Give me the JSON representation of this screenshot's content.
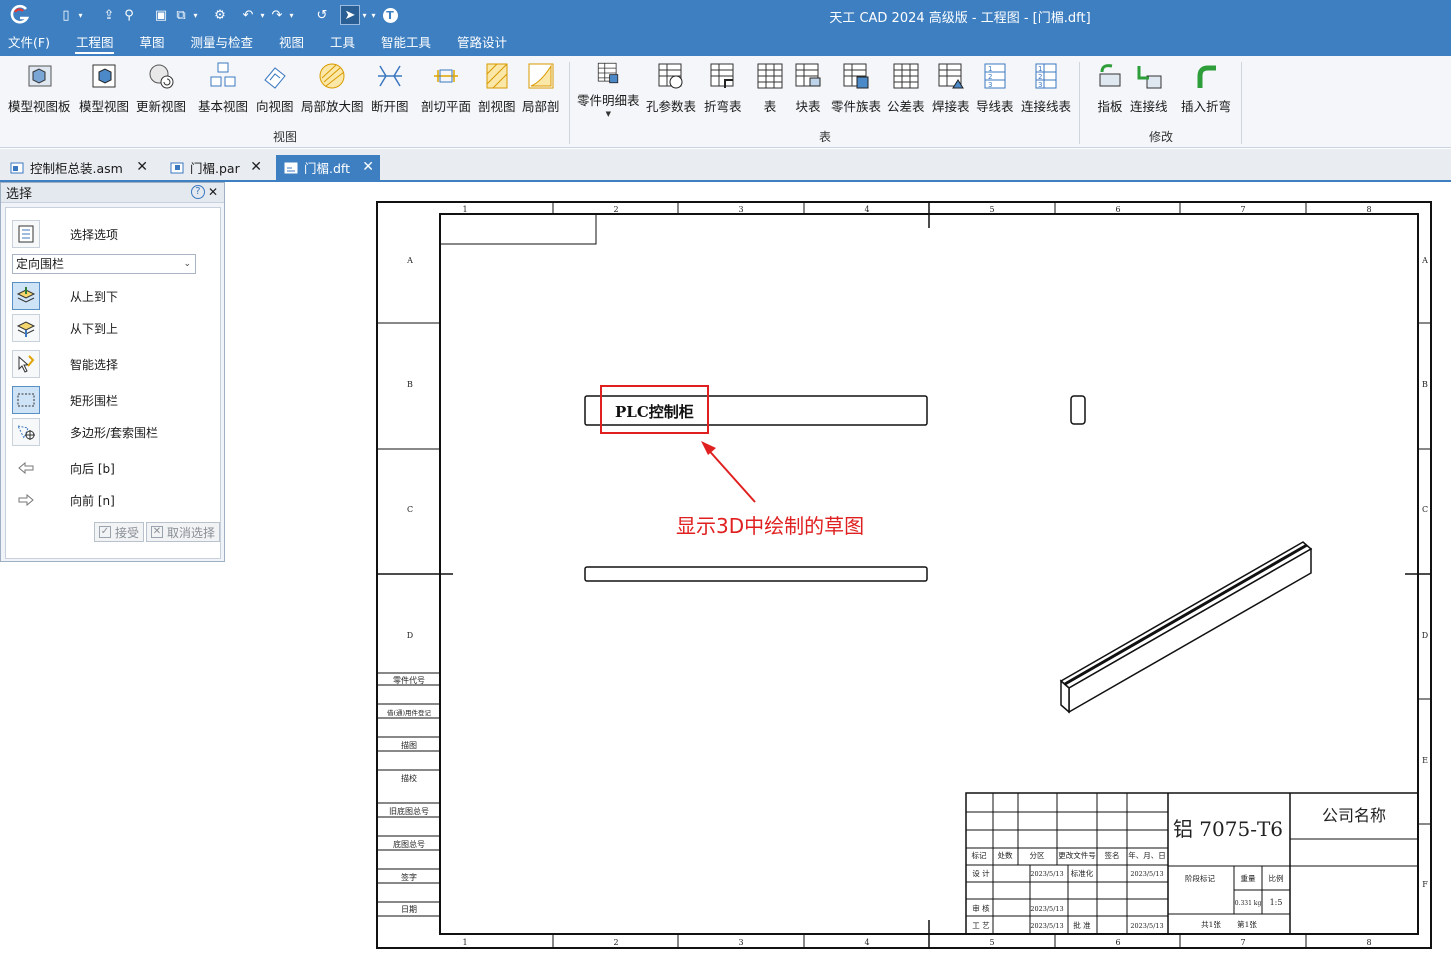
{
  "window": {
    "title": "天工 CAD 2024 高级版 - 工程图 - [门楣.dft]"
  },
  "menu": [
    "文件(F)",
    "工程图",
    "草图",
    "测量与检查",
    "视图",
    "工具",
    "智能工具",
    "管路设计"
  ],
  "ribbon": {
    "groups": [
      {
        "label": "视图",
        "buttons": [
          "模型视图板",
          "模型视图",
          "更新视图",
          "基本视图",
          "向视图",
          "局部放大图",
          "断开图",
          "剖切平面",
          "剖视图",
          "局部剖"
        ]
      },
      {
        "label": "表",
        "buttons": [
          "零件明细表",
          "孔参数表",
          "折弯表",
          "表",
          "块表",
          "零件族表",
          "公差表",
          "焊接表",
          "导线表",
          "连接线表"
        ]
      },
      {
        "label": "修改",
        "buttons": [
          "指板",
          "连接线",
          "插入折弯"
        ]
      }
    ]
  },
  "doc_tabs": [
    {
      "name": "控制柜总装.asm",
      "active": false
    },
    {
      "name": "门楣.par",
      "active": false
    },
    {
      "name": "门楣.dft",
      "active": true
    }
  ],
  "select_panel": {
    "title": "选择",
    "options_label": "选择选项",
    "fence_mode": "定向围栏",
    "items": [
      "从上到下",
      "从下到上",
      "智能选择",
      "矩形围栏",
      "多边形/套索围栏",
      "向后 [b]",
      "向前 [n]"
    ],
    "accept": "接受",
    "cancel": "取消选择"
  },
  "drawing": {
    "col_numbers": [
      "1",
      "2",
      "3",
      "4",
      "5",
      "6",
      "7",
      "8"
    ],
    "row_letters_left": [
      "A",
      "B",
      "C",
      "D"
    ],
    "row_letters_right": [
      "A",
      "B",
      "C",
      "D",
      "E",
      "F"
    ],
    "left_strip": [
      "零件代号",
      "借(通)用件登记",
      "描图",
      "描校",
      "旧底图总号",
      "底图总号",
      "签字",
      "日期"
    ],
    "sketch_text": "PLC控制柜",
    "annotation": "显示3D中绘制的草图",
    "title_block": {
      "material": "铝 7075-T6",
      "company": "公司名称",
      "headers": [
        "标记",
        "处数",
        "分区",
        "更改文件号",
        "签名",
        "年、月、日"
      ],
      "design": "设 计",
      "standardize": "标准化",
      "review": "审 核",
      "process": "工 艺",
      "approve": "批 准",
      "date": "2023/5/13",
      "stage_mark": "阶段标记",
      "weight_label": "重量",
      "scale_label": "比例",
      "weight": "0.331 kg",
      "scale": "1:5",
      "sheets_total": "共1张",
      "sheet_no": "第1张"
    }
  }
}
